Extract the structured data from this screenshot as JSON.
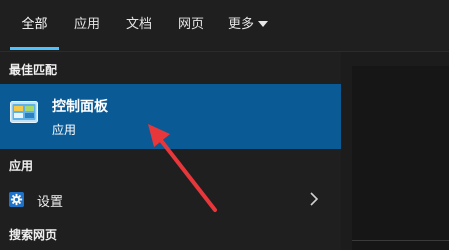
{
  "tabs": [
    {
      "label": "全部",
      "active": true
    },
    {
      "label": "应用",
      "active": false
    },
    {
      "label": "文档",
      "active": false
    },
    {
      "label": "网页",
      "active": false
    },
    {
      "label": "更多",
      "active": false
    }
  ],
  "sections": {
    "best_match": "最佳匹配",
    "apps": "应用",
    "web_search": "搜索网页"
  },
  "best_match_item": {
    "title": "控制面板",
    "subtitle": "应用",
    "icon": "control-panel-icon"
  },
  "settings_item": {
    "label": "设置",
    "icon": "gear-icon",
    "arrow_icon": "chevron-right-icon"
  },
  "colors": {
    "accent": "#4cc2ff",
    "selected_bg": "#0a5a96",
    "annotation_arrow": "#e8373a"
  }
}
